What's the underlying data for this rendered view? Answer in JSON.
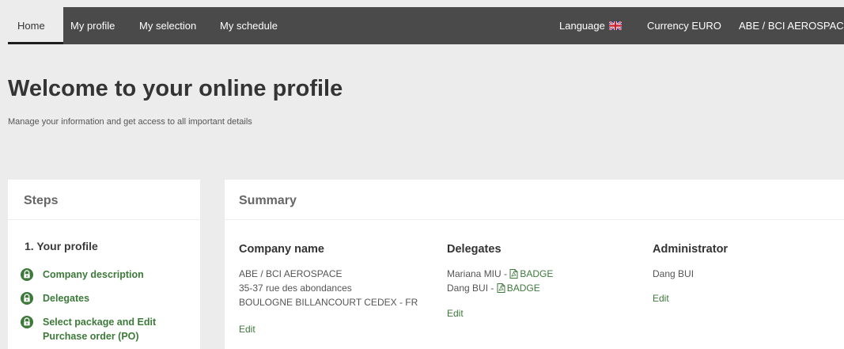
{
  "nav": {
    "home": "Home",
    "my_profile": "My profile",
    "my_selection": "My selection",
    "my_schedule": "My schedule",
    "language": "Language",
    "currency": "Currency EURO",
    "company": "ABE / BCI AEROSPACE C"
  },
  "hero": {
    "title": "Welcome to your online profile",
    "subtitle": "Manage your information and get access to all important details"
  },
  "steps": {
    "title": "Steps",
    "section": "1. Your profile",
    "items": [
      {
        "label": "Company description",
        "icon": "lock-open-icon"
      },
      {
        "label": "Delegates",
        "icon": "lock-open-icon"
      },
      {
        "label": "Select package and Edit Purchase order (PO)",
        "icon": "lock-open-icon"
      }
    ]
  },
  "summary": {
    "title": "Summary",
    "company": {
      "heading": "Company name",
      "lines": [
        "ABE / BCI AEROSPACE",
        "35-37 rue des abondances",
        "BOULOGNE BILLANCOURT CEDEX - FR"
      ],
      "edit": "Edit"
    },
    "delegates": {
      "heading": "Delegates",
      "people": [
        {
          "name": "Mariana MIU - ",
          "badge": "BADGE"
        },
        {
          "name": "Dang BUI - ",
          "badge": "BADGE"
        }
      ],
      "edit": "Edit"
    },
    "administrator": {
      "heading": "Administrator",
      "name": "Dang BUI",
      "edit": "Edit"
    }
  },
  "colors": {
    "nav_bg": "#4a4a4a",
    "accent_green": "#3d7a3a",
    "page_bg": "#ececec"
  }
}
